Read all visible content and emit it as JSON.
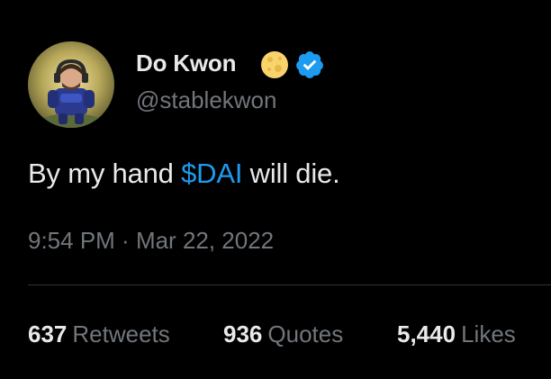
{
  "tweet": {
    "author": {
      "display_name": "Do Kwon",
      "handle": "@stablekwon",
      "badges": [
        "moon-emoji-icon",
        "verified-badge-icon"
      ]
    },
    "text_parts": {
      "before": "By my hand ",
      "cashtag": "$DAI",
      "after": " will die."
    },
    "timestamp": {
      "time": "9:54 PM",
      "separator": " · ",
      "date": "Mar 22, 2022"
    },
    "stats": {
      "retweets": {
        "count": "637",
        "label": "Retweets"
      },
      "quotes": {
        "count": "936",
        "label": "Quotes"
      },
      "likes": {
        "count": "5,440",
        "label": "Likes"
      }
    }
  },
  "colors": {
    "background": "#000000",
    "primary_text": "#e7e9ea",
    "secondary_text": "#71767b",
    "link": "#1d9bf0",
    "divider": "#2f3336",
    "verified": "#1d9bf0",
    "moon": "#f9d36b"
  }
}
